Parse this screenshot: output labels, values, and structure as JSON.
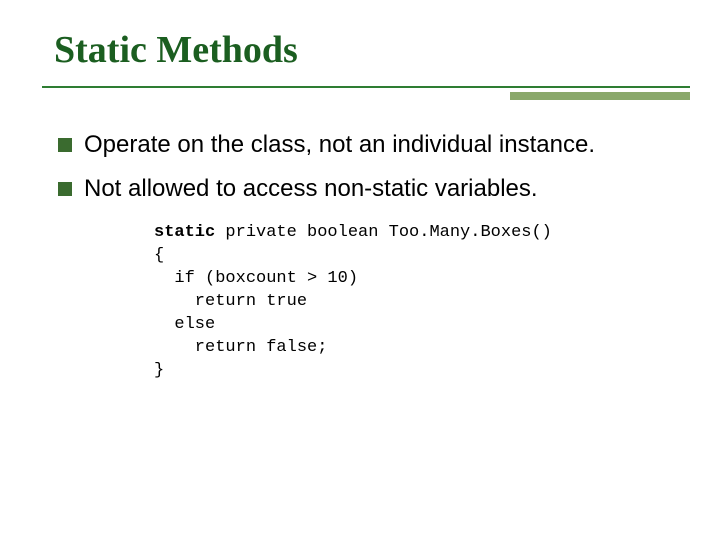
{
  "title": "Static Methods",
  "bullets": [
    "Operate on the class, not an individual instance.",
    "Not allowed to access non-static variables."
  ],
  "code": {
    "kw": "static",
    "line0_rest": " private boolean Too.Many.Boxes()",
    "line1": "{",
    "line2": "  if (boxcount > 10)",
    "line3": "    return true",
    "line4": "  else",
    "line5": "    return false;",
    "line6": "}"
  }
}
